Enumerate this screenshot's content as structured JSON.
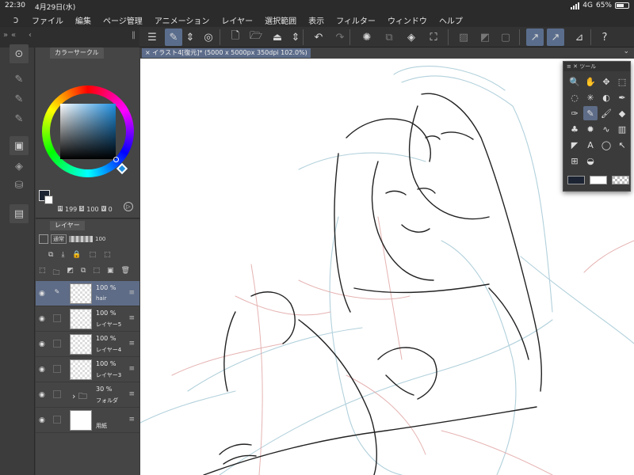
{
  "status": {
    "time": "22:30",
    "date": "4月29日(水)",
    "network": "4G",
    "battery": "65%",
    "battery_fraction": 0.65
  },
  "menu": {
    "logo_icon": "clip-studio-logo-icon",
    "items": [
      "ファイル",
      "編集",
      "ページ管理",
      "アニメーション",
      "レイヤー",
      "選択範囲",
      "表示",
      "フィルター",
      "ウィンドウ",
      "ヘルプ"
    ]
  },
  "toolbar": {
    "left_glyphs": [
      "»",
      "«",
      "‹",
      "‖"
    ],
    "buttons": [
      {
        "name": "menu-icon",
        "glyph": "☰",
        "active": false
      },
      {
        "name": "edit-mode-icon",
        "glyph": "✎",
        "active": true
      },
      {
        "name": "arrows-updown-icon",
        "glyph": "⇕",
        "active": false
      },
      {
        "name": "ring-icon",
        "glyph": "◎",
        "active": false
      },
      {
        "name": "new-file-icon",
        "glyph": "🗋",
        "active": false
      },
      {
        "name": "open-folder-icon",
        "glyph": "🗁",
        "active": false
      },
      {
        "name": "save-icon",
        "glyph": "⏏",
        "active": false
      },
      {
        "name": "arrows-updown-2-icon",
        "glyph": "⇕",
        "active": false
      },
      {
        "name": "undo-icon",
        "glyph": "↶",
        "active": false
      },
      {
        "name": "redo-icon",
        "glyph": "↷",
        "active": false,
        "dim": true
      },
      {
        "name": "loading-icon",
        "glyph": "✺",
        "active": false
      },
      {
        "name": "copy-icon",
        "glyph": "⧉",
        "active": false,
        "dim": true
      },
      {
        "name": "fill-icon",
        "glyph": "◈",
        "active": false
      },
      {
        "name": "transform-icon",
        "glyph": "⛶",
        "active": false
      },
      {
        "name": "deselect-icon",
        "glyph": "▨",
        "active": false,
        "dim": true
      },
      {
        "name": "invert-selection-icon",
        "glyph": "◩",
        "active": false,
        "dim": true
      },
      {
        "name": "crop-icon",
        "glyph": "▢",
        "active": false,
        "dim": true
      },
      {
        "name": "ruler-snap-icon",
        "glyph": "↗",
        "active": true
      },
      {
        "name": "special-ruler-icon",
        "glyph": "↗",
        "active": true
      },
      {
        "name": "grid-snap-icon",
        "glyph": "⊿",
        "active": false
      },
      {
        "name": "help-icon",
        "glyph": "?",
        "active": false
      }
    ]
  },
  "left_strip": {
    "items": [
      {
        "name": "navigator-icon",
        "glyph": "⊙",
        "boxed": true
      },
      {
        "name": "sub-tool-pen-icon",
        "glyph": "✎",
        "boxed": false
      },
      {
        "name": "sub-tool-brush-icon",
        "glyph": "✎",
        "boxed": false
      },
      {
        "name": "sub-tool-pencil-icon",
        "glyph": "✎",
        "boxed": false
      },
      {
        "name": "color-panel-icon",
        "glyph": "▣",
        "boxed": true
      },
      {
        "name": "layers-icon",
        "glyph": "◈",
        "boxed": false
      },
      {
        "name": "material-icon",
        "glyph": "⛁",
        "boxed": false
      },
      {
        "name": "file-icon",
        "glyph": "▤",
        "boxed": true
      }
    ]
  },
  "color_panel": {
    "tab_label": "カラーサークル",
    "h": "199",
    "s": "100",
    "v": "0",
    "h_label": "H",
    "s_label": "S",
    "v_label": "V",
    "main_color": "#1c2433",
    "sub_color": "#ffffff",
    "hue_color": "#1f8fe0"
  },
  "layer_panel": {
    "tab_label": "レイヤー",
    "blend_mode": "通常",
    "opacity": "100",
    "row1_icons": [
      "⧉",
      "⤓",
      "🔒",
      "⬚",
      "⬚"
    ],
    "row2_icons": [
      "⬚",
      "🗀",
      "◩",
      "⧉",
      "⬚",
      "▣",
      "🗑"
    ],
    "layers": [
      {
        "opacity": "100 %",
        "name": "hair",
        "active": true,
        "thumb": "transparent",
        "edit_icon": "✎"
      },
      {
        "opacity": "100 %",
        "name": "レイヤー5",
        "active": false,
        "thumb": "transparent"
      },
      {
        "opacity": "100 %",
        "name": "レイヤー4",
        "active": false,
        "thumb": "transparent"
      },
      {
        "opacity": "100 %",
        "name": "レイヤー3",
        "active": false,
        "thumb": "transparent"
      },
      {
        "opacity": "30 %",
        "name": "フォルダ",
        "active": false,
        "thumb": "folder"
      },
      {
        "opacity": "",
        "name": "用紙",
        "active": false,
        "thumb": "paper"
      }
    ]
  },
  "canvas": {
    "tab_label": "イラスト4[復元]* (5000 x 5000px 350dpi 102.0%)"
  },
  "tool_palette": {
    "title": "ツール",
    "tools": [
      {
        "name": "zoom-icon",
        "glyph": "🔍"
      },
      {
        "name": "hand-icon",
        "glyph": "✋"
      },
      {
        "name": "move-icon",
        "glyph": "✥"
      },
      {
        "name": "operation-icon",
        "glyph": "⬚"
      },
      {
        "name": "lasso-icon",
        "glyph": "◌"
      },
      {
        "name": "magic-wand-icon",
        "glyph": "✳"
      },
      {
        "name": "auto-select-icon",
        "glyph": "◐"
      },
      {
        "name": "eyedropper-icon",
        "glyph": "✒"
      },
      {
        "name": "pen-icon",
        "glyph": "✑"
      },
      {
        "name": "pencil-icon",
        "glyph": "✎",
        "selected": true
      },
      {
        "name": "brush-icon",
        "glyph": "🖌"
      },
      {
        "name": "eraser-icon",
        "glyph": "◆"
      },
      {
        "name": "decoration-icon",
        "glyph": "♣"
      },
      {
        "name": "airbrush-icon",
        "glyph": "✹"
      },
      {
        "name": "figure-icon",
        "glyph": "∿"
      },
      {
        "name": "gradient-icon",
        "glyph": "▥"
      },
      {
        "name": "frame-icon",
        "glyph": "◤"
      },
      {
        "name": "text-icon",
        "glyph": "A"
      },
      {
        "name": "balloon-icon",
        "glyph": "◯"
      },
      {
        "name": "object-icon",
        "glyph": "↖"
      },
      {
        "name": "ruler-icon",
        "glyph": "⊞"
      },
      {
        "name": "fill-tool-icon",
        "glyph": "◒"
      }
    ],
    "colors": [
      "#1c2433",
      "#ffffff",
      "checker"
    ]
  }
}
